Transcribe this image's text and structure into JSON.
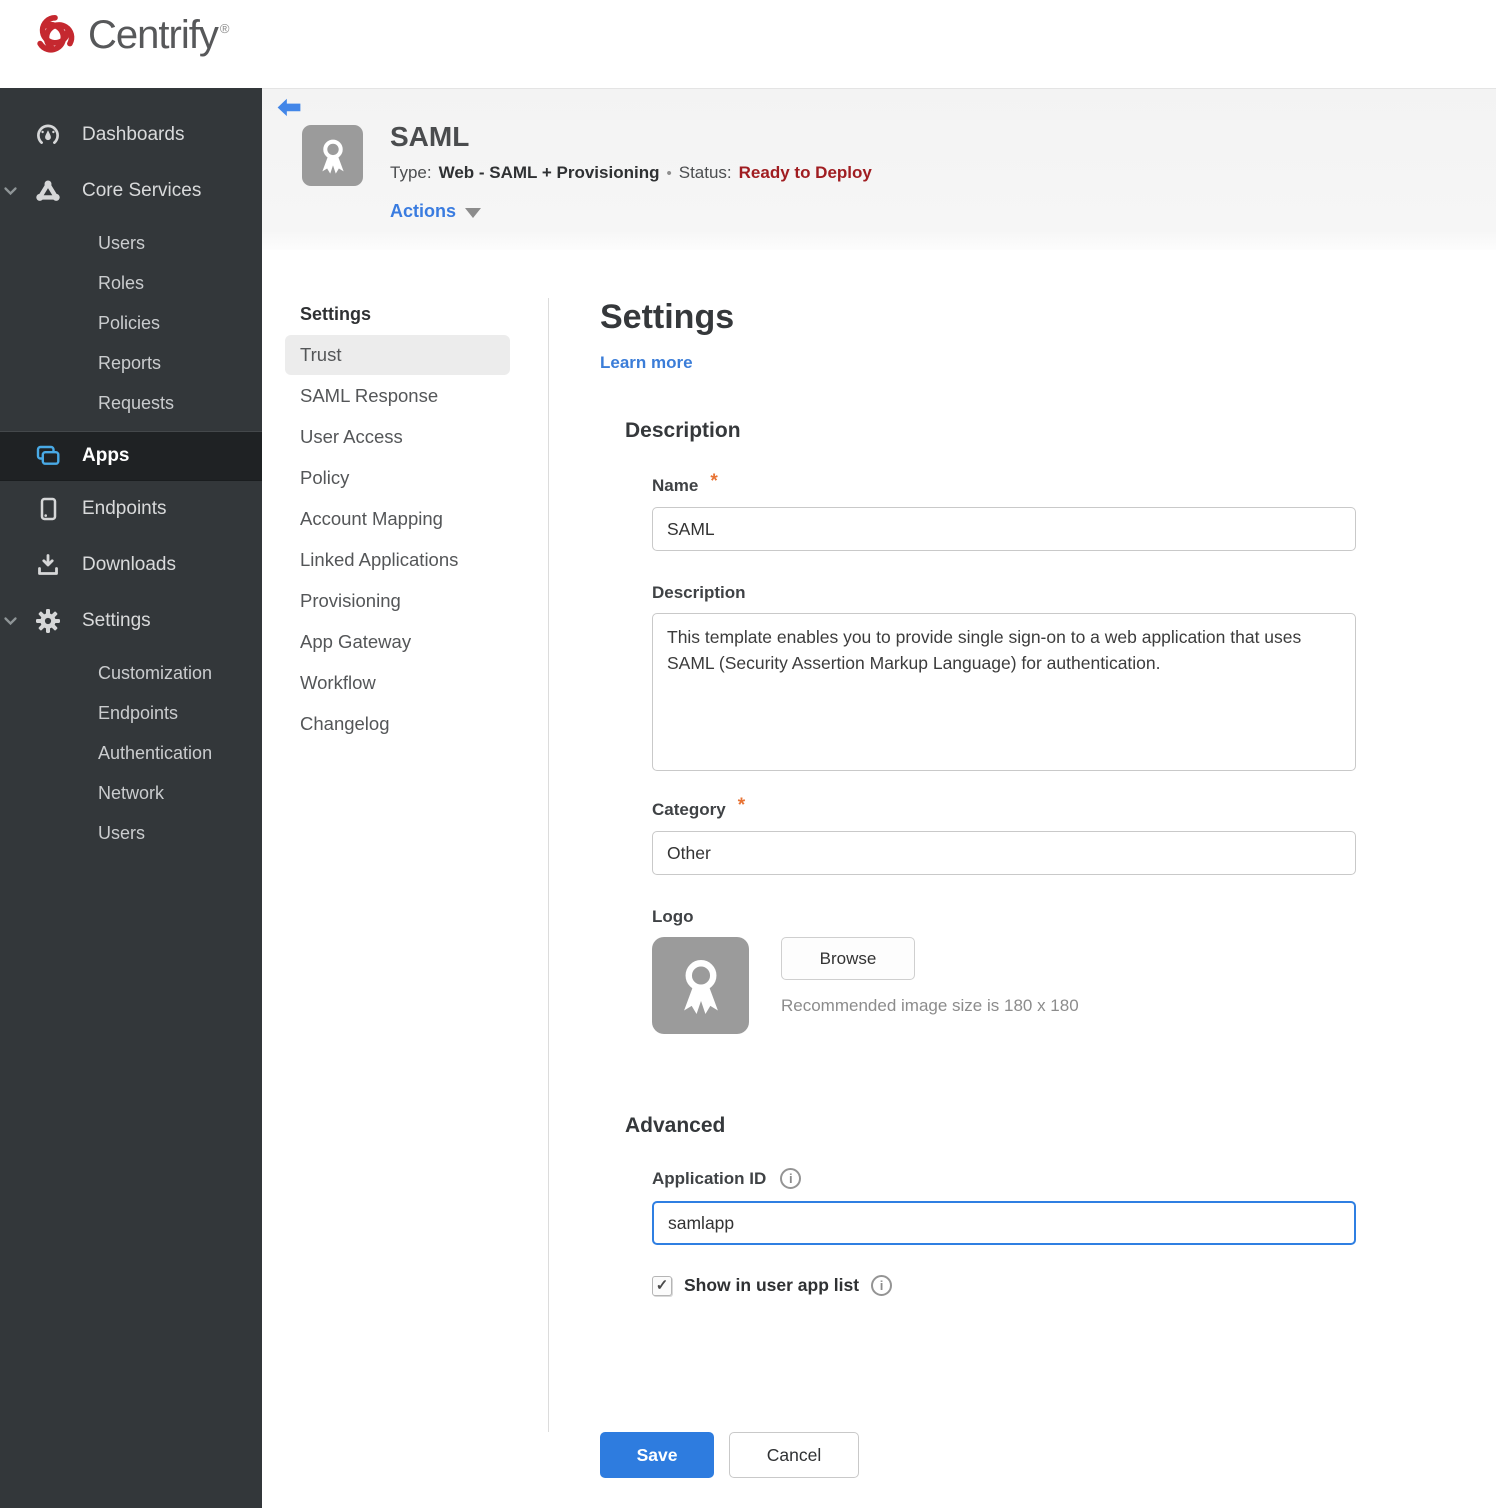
{
  "brand": {
    "name": "Centrify",
    "registered": "®"
  },
  "sidebar": {
    "dashboards": "Dashboards",
    "core_services": "Core Services",
    "core_children": [
      "Users",
      "Roles",
      "Policies",
      "Reports",
      "Requests"
    ],
    "apps": "Apps",
    "endpoints": "Endpoints",
    "downloads": "Downloads",
    "settings": "Settings",
    "settings_children": [
      "Customization",
      "Endpoints",
      "Authentication",
      "Network",
      "Users"
    ]
  },
  "header": {
    "app_title": "SAML",
    "type_label": "Type:",
    "type_value": "Web - SAML + Provisioning",
    "separator": "•",
    "status_label": "Status:",
    "status_value": "Ready to Deploy",
    "actions_label": "Actions"
  },
  "subnav": {
    "header": "Settings",
    "items": [
      "Trust",
      "SAML Response",
      "User Access",
      "Policy",
      "Account Mapping",
      "Linked Applications",
      "Provisioning",
      "App Gateway",
      "Workflow",
      "Changelog"
    ],
    "selected": "Trust"
  },
  "main": {
    "title": "Settings",
    "learn_more": "Learn more",
    "description_section": {
      "heading": "Description",
      "name_label": "Name",
      "name_value": "SAML",
      "description_label": "Description",
      "description_value": "This template enables you to provide single sign-on to a web application that uses SAML (Security Assertion Markup Language) for authentication.",
      "category_label": "Category",
      "category_value": "Other",
      "logo_label": "Logo",
      "browse_label": "Browse",
      "logo_hint": "Recommended image size is 180 x 180"
    },
    "advanced_section": {
      "heading": "Advanced",
      "application_id_label": "Application ID",
      "application_id_value": "samlapp",
      "show_in_user_app_list_label": "Show in user app list",
      "checkbox_checked": true
    },
    "footer": {
      "save_label": "Save",
      "cancel_label": "Cancel"
    }
  },
  "icons": {
    "info": "i",
    "checkmark": "✓"
  },
  "required_marker": "*",
  "colors": {
    "accent_blue": "#3b7dd8",
    "save_blue": "#2e7cdf",
    "status_red": "#a01d21",
    "apps_cyan": "#49aae6",
    "required_orange": "#e87334",
    "sidebar_bg": "#33373a",
    "sidebar_active_bg": "#1f2224"
  }
}
